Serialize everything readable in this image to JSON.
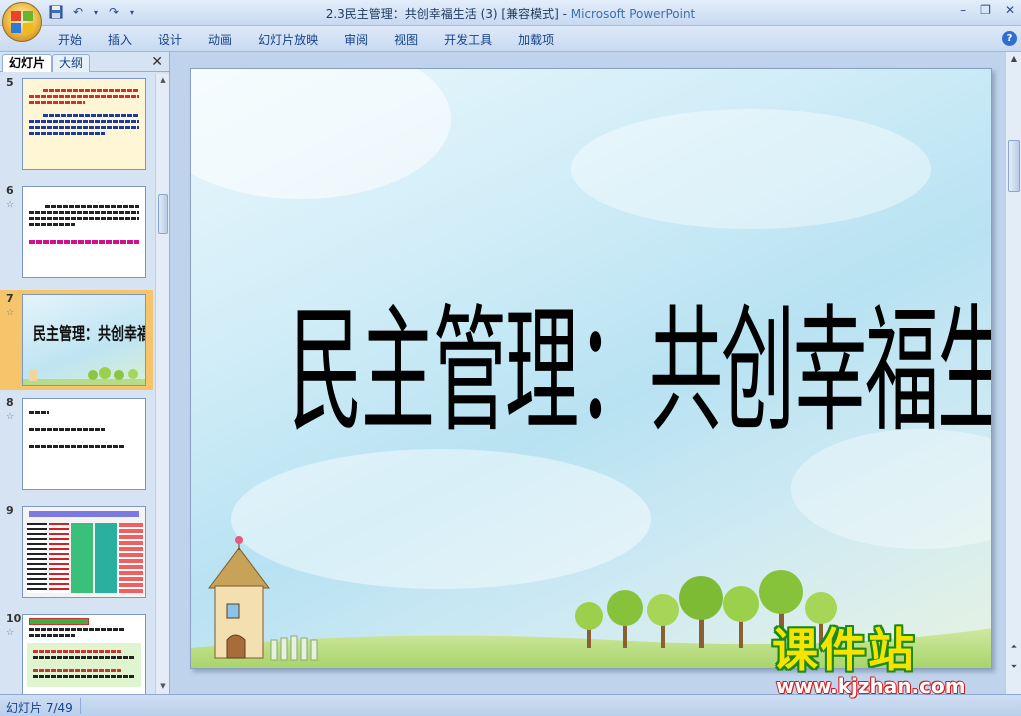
{
  "window": {
    "title_doc": "2.3民主管理：共创幸福生活 (3) [兼容模式] - ",
    "title_app": "Microsoft PowerPoint"
  },
  "ribbon": {
    "tabs": [
      "开始",
      "插入",
      "设计",
      "动画",
      "幻灯片放映",
      "审阅",
      "视图",
      "开发工具",
      "加载项"
    ]
  },
  "panel": {
    "tab_slides": "幻灯片",
    "tab_outline": "大纲",
    "close_glyph": "✕",
    "thumbnails": [
      {
        "number": "5",
        "anim": "",
        "selected": false
      },
      {
        "number": "6",
        "anim": "",
        "selected": false
      },
      {
        "number": "7",
        "anim": "",
        "selected": true,
        "title": "民主管理：共创幸福生活"
      },
      {
        "number": "8",
        "anim": "",
        "selected": false
      },
      {
        "number": "9",
        "anim": "",
        "selected": false
      },
      {
        "number": "10",
        "anim": "",
        "selected": false
      }
    ]
  },
  "slide": {
    "title": "民主管理：共创幸福生活"
  },
  "status": {
    "slide_counter": "幻灯片 7/49"
  },
  "watermark": {
    "brand": "课件站",
    "url": "www.kjzhan.com"
  },
  "colors": {
    "selection": "#f6c46a",
    "ribbon_text": "#15428b",
    "watermark_yellow": "#f5e400"
  },
  "icons": {
    "office": "office-button-icon",
    "save": "save-icon",
    "undo": "undo-icon",
    "redo": "redo-icon",
    "help": "help-icon"
  }
}
